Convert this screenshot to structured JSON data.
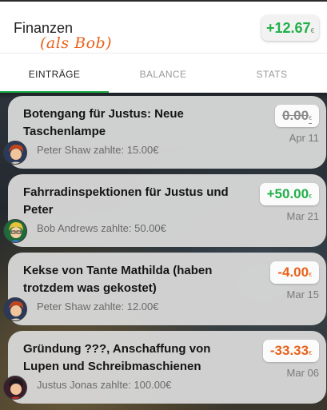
{
  "header": {
    "title": "Finanzen",
    "annotation": "(als Bob)",
    "balance": {
      "value": "+12.67",
      "currency": "€"
    }
  },
  "tabs": [
    {
      "label": "EINTRÄGE",
      "active": true
    },
    {
      "label": "BALANCE",
      "active": false
    },
    {
      "label": "STATS",
      "active": false
    }
  ],
  "entries": [
    {
      "title": "Botengang für Justus: Neue Taschenlampe",
      "payer": "Peter Shaw zahlte: 15.00€",
      "amount": "0.00",
      "currency": "€",
      "date": "Apr 11",
      "avatar": "peter-avatar"
    },
    {
      "title": "Fahrradinspektionen für Justus und Peter",
      "payer": "Bob Andrews zahlte: 50.00€",
      "amount": "+50.00",
      "currency": "€",
      "date": "Mar 21",
      "avatar": "bob-avatar"
    },
    {
      "title": "Kekse von Tante Mathilda (haben trotzdem was gekostet)",
      "payer": "Peter Shaw zahlte: 12.00€",
      "amount": "-4.00",
      "currency": "€",
      "date": "Mar 15",
      "avatar": "peter-avatar"
    },
    {
      "title": "Gründung ???, Anschaffung von Lupen und Schreibmaschienen",
      "payer": "Justus Jonas zahlte: 100.00€",
      "amount": "-33.33",
      "currency": "€",
      "date": "Mar 06",
      "avatar": "justus-avatar"
    }
  ],
  "colors": {
    "accent": "#22b04a",
    "negative": "#e8621c",
    "annotation": "#e8621c"
  }
}
